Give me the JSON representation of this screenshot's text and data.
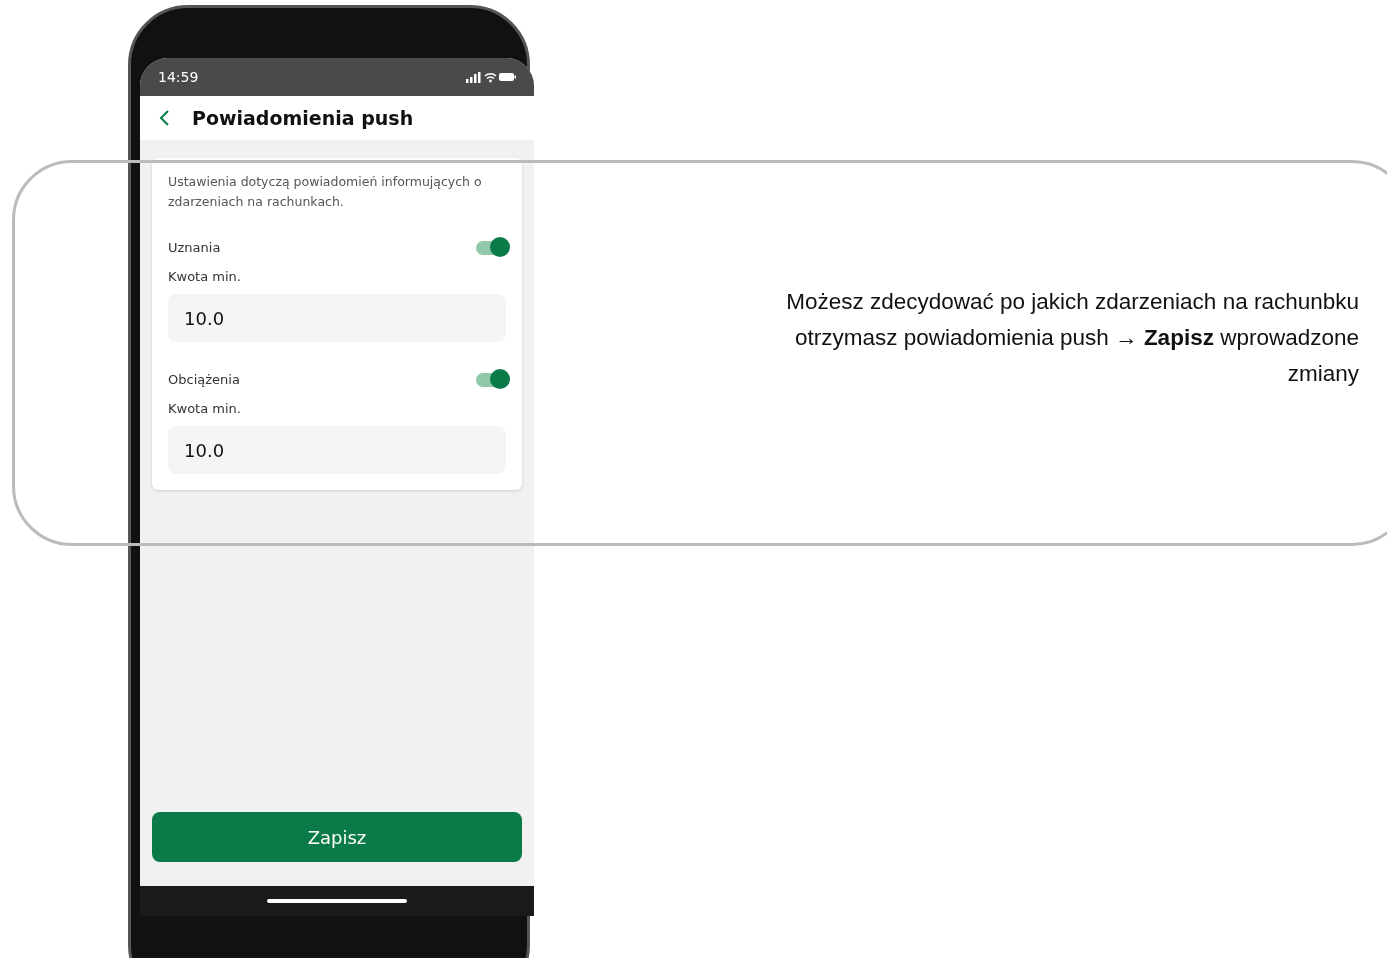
{
  "status_bar": {
    "time": "14:59"
  },
  "header": {
    "title": "Powiadomienia push"
  },
  "settings_card": {
    "description": "Ustawienia dotyczą powiadomień informujących o zdarzeniach na rachunkach.",
    "sections": [
      {
        "label": "Uznania",
        "on": true,
        "amount_label": "Kwota min.",
        "amount_value": "10.0"
      },
      {
        "label": "Obciążenia",
        "on": true,
        "amount_label": "Kwota min.",
        "amount_value": "10.0"
      }
    ]
  },
  "save_button": {
    "label": "Zapisz"
  },
  "caption": "Możesz zdecydować po jakich zdarzeniach na rachunbku otrzymasz powiadomienia push → **Zapisz** wprowadzone zmiany"
}
